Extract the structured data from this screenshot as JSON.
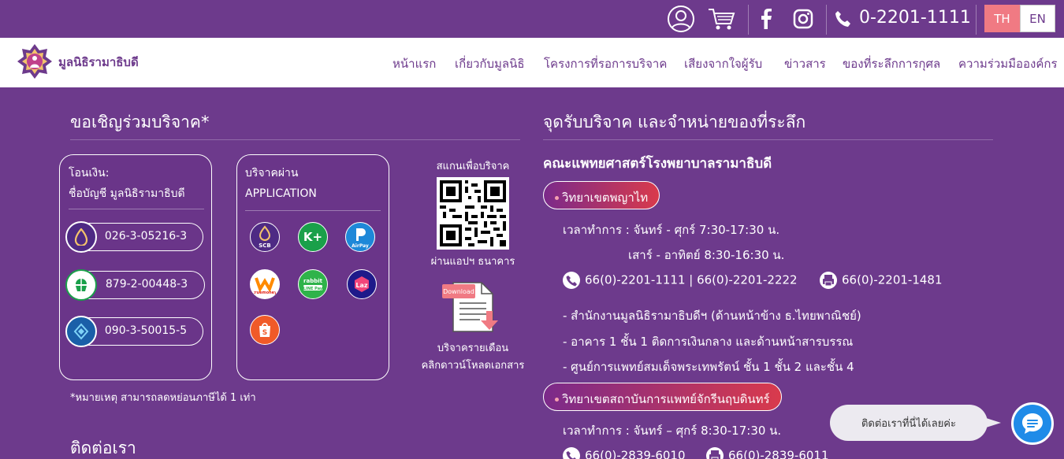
{
  "topbar": {
    "phone": "0-2201-1111",
    "lang_th": "TH",
    "lang_en": "EN",
    "icons": [
      "user-icon",
      "cart-icon",
      "facebook-icon",
      "instagram-icon",
      "phone-icon"
    ]
  },
  "nav": {
    "logo_text": "มูลนิธิรามาธิบดี",
    "items": [
      "หน้าแรก",
      "เกี่ยวกับมูลนิธิ",
      "โครงการที่รอการบริจาค",
      "เสียงจากใจผู้รับ",
      "ข่าวสาร",
      "ของที่ระลึกการกุศล",
      "ความร่วมมือองค์กร"
    ]
  },
  "donate": {
    "title": "ขอเชิญร่วมบริจาค*",
    "transfer_head_1": "โอนเงิน:",
    "transfer_head_2": "ชื่อบัญชี มูลนิธิรามาธิบดี",
    "accounts": [
      {
        "number": "026-3-05216-3",
        "bank": "SCB",
        "color": "#4e2a84"
      },
      {
        "number": "879-2-00448-3",
        "bank": "KBANK",
        "color": "#1aa04a"
      },
      {
        "number": "090-3-50015-5",
        "bank": "KTB",
        "color": "#1a9bd7"
      }
    ],
    "app_head_1": "บริจาคผ่าน",
    "app_head_2": "APPLICATION",
    "apps": [
      {
        "label": "SCB",
        "color": "#4e2a84"
      },
      {
        "label": "K+",
        "color": "#1aa04a"
      },
      {
        "label": "AirPay",
        "color": "#1e88d8"
      },
      {
        "label": "truemoney",
        "color": "#ff8a00"
      },
      {
        "label": "rabbit LINE Pay",
        "color": "#2fb34a"
      },
      {
        "label": "Laz",
        "color": "#1e1a8a"
      },
      {
        "label": "S",
        "color": "#f05a28"
      }
    ],
    "qr_label": "สแกนเพื่อบริจาค",
    "qr_caption": "ผ่านแอปฯ ธนาคาร",
    "download_tag": "Download",
    "monthly_1": "บริจาครายเดือน",
    "monthly_2": "คลิกดาวน์โหลดเอกสาร",
    "note": "*หมายเหตุ สามารถลดหย่อนภาษีได้ 1 เท่า"
  },
  "contact": {
    "title": "ติดต่อเรา"
  },
  "points": {
    "title": "จุดรับบริจาค และจำหน่ายของที่ระลึก",
    "org": "คณะแพทยศาสตร์โรงพยาบาลรามาธิบดี",
    "campus1": "วิทยาเขตพญาไท",
    "hours1": "เวลาทำการ : จันทร์ - ศุกร์ 7:30-17:30 น.",
    "hours1b": "เสาร์ - อาทิตย์ 8:30-16:30 น.",
    "tel1": "66(0)-2201-1111 | 66(0)-2201-2222",
    "fax1": "66(0)-2201-1481",
    "loc1": "- สำนักงานมูลนิธิรามาธิบดีฯ (ด้านหน้าข้าง ธ.ไทยพาณิชย์)",
    "loc2": "- อาคาร 1 ชั้น 1 ติดการเงินกลาง และด้านหน้าสารบรรณ",
    "loc3": "- ศูนย์การแพทย์สมเด็จพระเทพรัตน์ ชั้น 1 ชั้น 2 และชั้น 4",
    "campus2": "วิทยาเขตสถาบันการแพทย์จักรีนฤบดินทร์",
    "hours2": "เวลาทำการ : จันทร์ – ศุกร์ 8:30-17:30 น.",
    "tel2": "66(0)-2839-6010",
    "fax2": "66(0)-2839-6011"
  },
  "chat": {
    "bubble": "ติดต่อเราที่นี่ได้เลยค่ะ"
  }
}
